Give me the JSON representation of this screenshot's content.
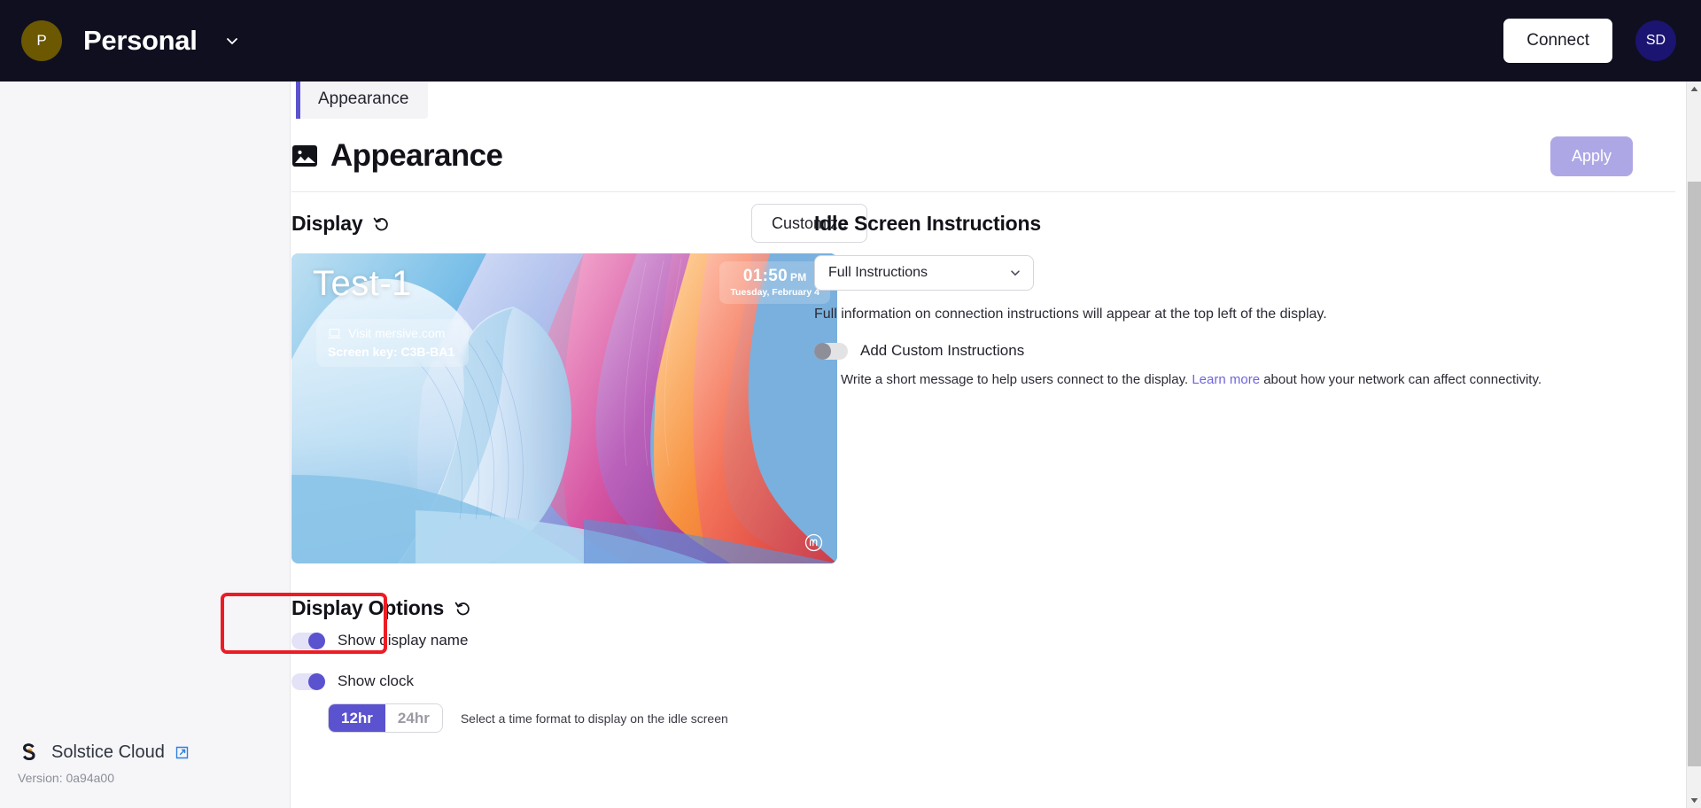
{
  "topbar": {
    "org_avatar_initial": "P",
    "org_avatar_color": "#6b5800",
    "org_name": "Personal",
    "org_chevron_icon": "chevron-down-icon",
    "connect_label": "Connect",
    "user_avatar_initials": "SD",
    "user_avatar_color": "#1b1470"
  },
  "sidebar": {
    "brand_name": "Solstice Cloud",
    "brand_logo_icon": "solstice-s-logo",
    "external_link_icon": "external-link-icon",
    "version": "Version: 0a94a00"
  },
  "tabs": [
    {
      "label": "Appearance",
      "active": true
    }
  ],
  "page": {
    "title": "Appearance",
    "title_icon": "image-icon",
    "apply_label": "Apply",
    "apply_color": "#aea7e6"
  },
  "display_section": {
    "title": "Display",
    "reset_icon": "reset-arrow-icon",
    "customize_label": "Customize",
    "preview": {
      "display_name": "Test-1",
      "laptop_icon": "laptop-icon",
      "visit_text": "Visit mersive.com",
      "screen_key": "Screen key: C3B-BA1",
      "clock_time": "01:50",
      "clock_ampm": "PM",
      "clock_date": "Tuesday, February 4",
      "watermark_icon": "mersive-m-logo"
    }
  },
  "display_options": {
    "title": "Display Options",
    "reset_icon": "reset-arrow-icon",
    "items": [
      {
        "label": "Show display name",
        "state": "on"
      },
      {
        "label": "Show clock",
        "state": "on"
      }
    ],
    "time_format": {
      "options": [
        "12hr",
        "24hr"
      ],
      "selected": "12hr",
      "hint": "Select a time format to display on the idle screen",
      "accent_color": "#5b52cf"
    }
  },
  "idle_screen": {
    "title": "Idle Screen Instructions",
    "select_value": "Full Instructions",
    "select_chevron_icon": "chevron-down-icon",
    "description": "Full information on connection instructions will appear at the top left of the display.",
    "custom_toggle_label": "Add Custom Instructions",
    "custom_toggle_state": "off",
    "sub_text_before": "Write a short message to help users connect to the display. ",
    "sub_link": "Learn more",
    "sub_text_after": " about how your network can affect connectivity.",
    "link_color": "#6f64db"
  },
  "highlight": {
    "color": "#ed1c24"
  },
  "scrollbar": {
    "up_icon": "caret-up-icon",
    "down_icon": "caret-down-icon"
  }
}
